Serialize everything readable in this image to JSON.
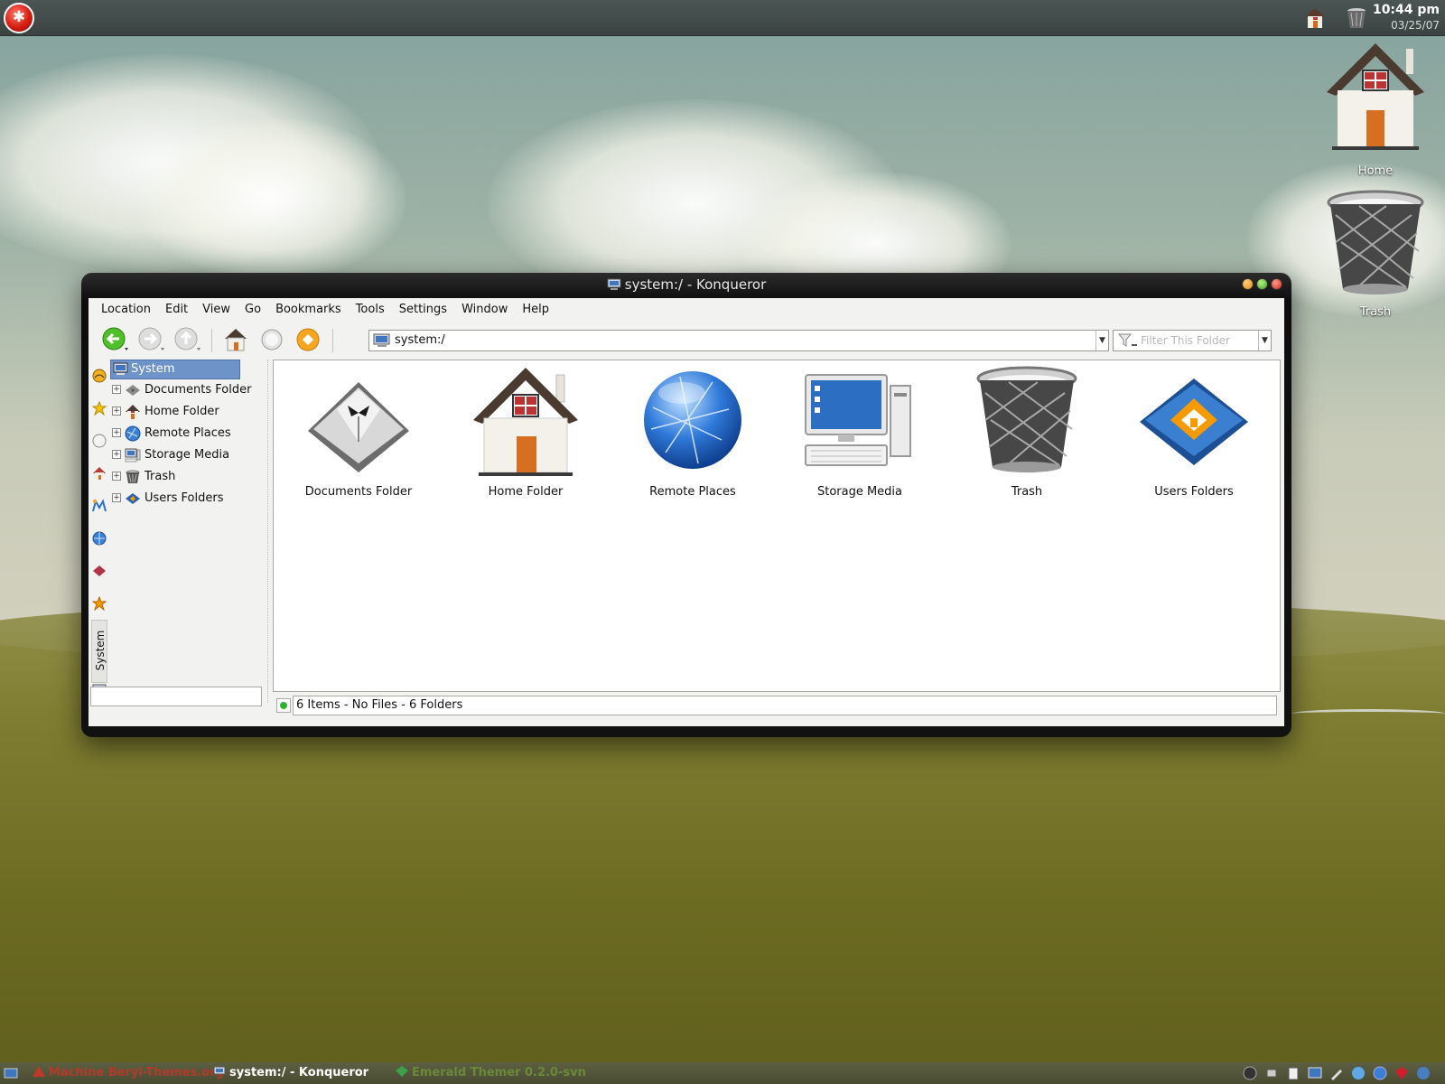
{
  "panel": {
    "clock_time": "10:44 pm",
    "clock_date": "03/25/07"
  },
  "desktop": {
    "icons": [
      {
        "label": "Home",
        "icon": "home-icon"
      },
      {
        "label": "Trash",
        "icon": "trash-icon"
      }
    ]
  },
  "window": {
    "title": "system:/ - Konqueror",
    "menu": [
      "Location",
      "Edit",
      "View",
      "Go",
      "Bookmarks",
      "Tools",
      "Settings",
      "Window",
      "Help"
    ],
    "location_value": "system:/",
    "filter_placeholder": "Filter This Folder",
    "sidebar_tab_label": "System",
    "tree": {
      "root": "System",
      "items": [
        {
          "label": "Documents Folder",
          "icon": "documents-folder-icon"
        },
        {
          "label": "Home Folder",
          "icon": "home-folder-icon"
        },
        {
          "label": "Remote Places",
          "icon": "remote-places-icon"
        },
        {
          "label": "Storage Media",
          "icon": "storage-media-icon"
        },
        {
          "label": "Trash",
          "icon": "trash-icon"
        },
        {
          "label": "Users Folders",
          "icon": "users-folders-icon"
        }
      ]
    },
    "items": [
      {
        "label": "Documents Folder",
        "icon": "documents-folder-icon"
      },
      {
        "label": "Home Folder",
        "icon": "home-folder-icon"
      },
      {
        "label": "Remote Places",
        "icon": "remote-places-icon"
      },
      {
        "label": "Storage Media",
        "icon": "storage-media-icon"
      },
      {
        "label": "Trash",
        "icon": "trash-icon"
      },
      {
        "label": "Users Folders",
        "icon": "users-folders-icon"
      }
    ],
    "status": "6 Items - No Files - 6 Folders"
  },
  "taskbar": {
    "tasks": [
      {
        "label": "Machine Beryl-Themes.org",
        "color": "#b23a2a"
      },
      {
        "label": "system:/ - Konqueror",
        "color": "#ffffff"
      },
      {
        "label": "Emerald Themer 0.2.0-svn",
        "color": "#6a8a3a"
      }
    ]
  },
  "colors": {
    "accent": "#6e93c9",
    "window_frame": "#111111"
  }
}
